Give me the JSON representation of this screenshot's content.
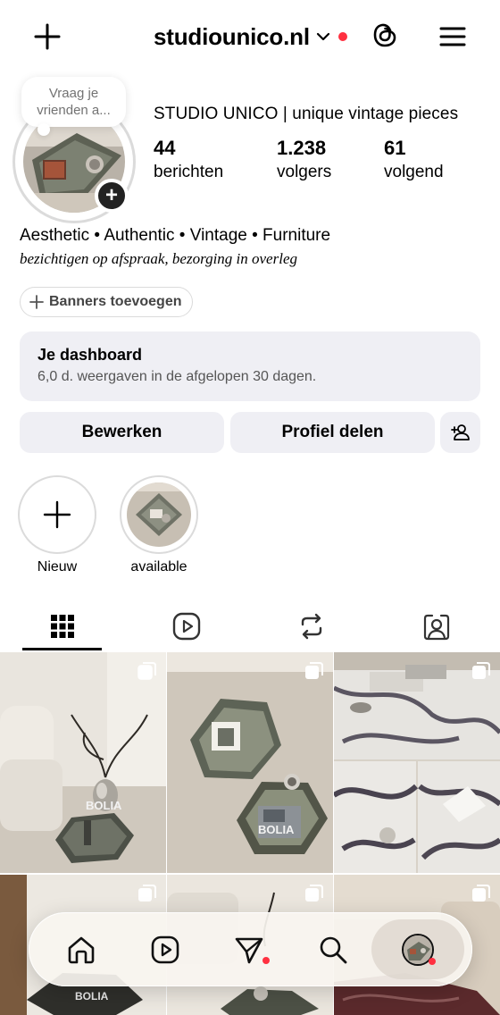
{
  "header": {
    "username": "studiounico.nl",
    "icons": [
      "plus-icon",
      "chevron-down-icon",
      "threads-icon",
      "hamburger-menu-icon"
    ],
    "notification_color": "#ff3040"
  },
  "profile": {
    "note_placeholder": "Vraag je vrienden a...",
    "full_name": "STUDIO UNICO | unique vintage pieces",
    "stats": [
      {
        "value": "44",
        "label": "berichten"
      },
      {
        "value": "1.238",
        "label": "volgers"
      },
      {
        "value": "61",
        "label": "volgend"
      }
    ],
    "bio_line1": "Aesthetic • Authentic • Vintage • Furniture",
    "bio_line2": "bezichtigen op afspraak, bezorging in overleg",
    "add_story_symbol": "+"
  },
  "banners": {
    "label": "Banners toevoegen"
  },
  "dashboard": {
    "title": "Je dashboard",
    "subtitle": "6,0 d. weergaven in de afgelopen 30 dagen."
  },
  "actions": {
    "edit_label": "Bewerken",
    "share_label": "Profiel delen"
  },
  "highlights": [
    {
      "label": "Nieuw",
      "icon": "plus-icon"
    },
    {
      "label": "available",
      "icon": "highlight-thumbnail"
    }
  ],
  "tabs": [
    {
      "name": "posts",
      "icon": "grid-icon",
      "active": true
    },
    {
      "name": "reels",
      "icon": "reels-icon",
      "active": false
    },
    {
      "name": "reposts",
      "icon": "repost-icon",
      "active": false
    },
    {
      "name": "tagged",
      "icon": "tagged-person-icon",
      "active": false
    }
  ],
  "grid": {
    "posts": [
      {
        "watermark": "BOLIA",
        "multi": true
      },
      {
        "watermark": "BOLIA",
        "multi": true
      },
      {
        "watermark": "",
        "multi": true
      },
      {
        "watermark": "",
        "multi": true
      },
      {
        "watermark": "",
        "multi": true
      },
      {
        "watermark": "",
        "multi": true
      }
    ],
    "bottom_left_watermark": "BOLIA"
  },
  "bottom_nav": {
    "items": [
      "home-icon",
      "reels-icon",
      "direct-messages-icon",
      "search-icon",
      "profile-avatar"
    ],
    "badges": [
      "direct-messages",
      "profile"
    ]
  }
}
